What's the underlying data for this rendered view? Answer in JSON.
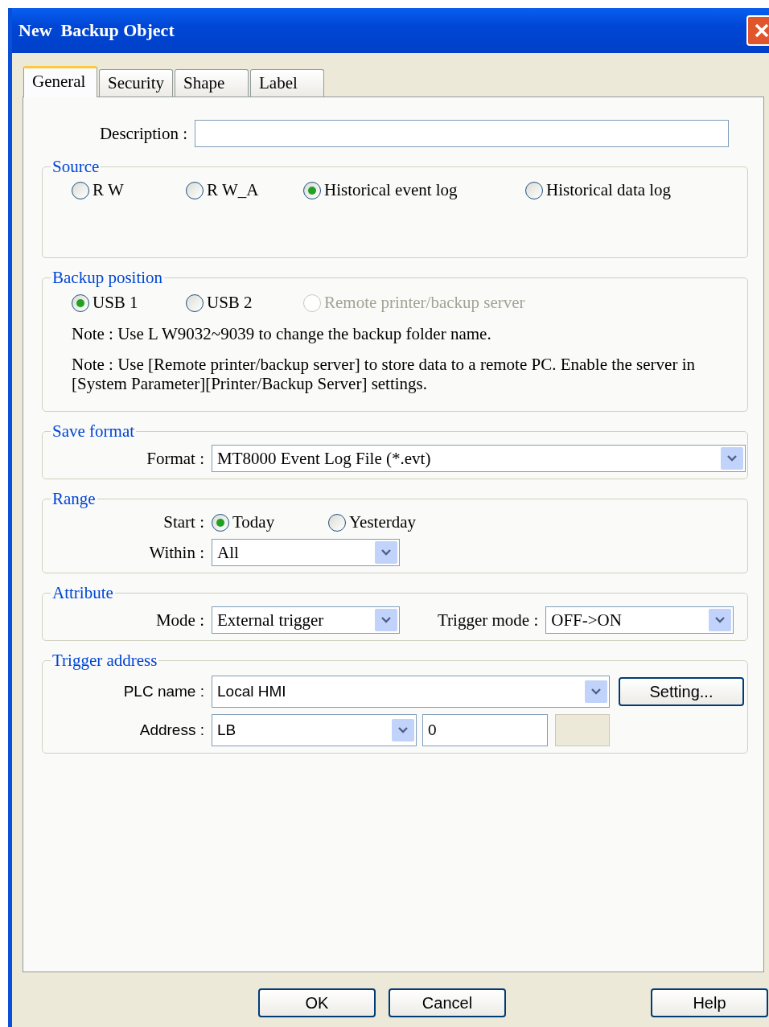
{
  "window": {
    "title": "New  Backup Object"
  },
  "tabs": [
    {
      "label": "General",
      "selected": true
    },
    {
      "label": "Security",
      "selected": false
    },
    {
      "label": "Shape",
      "selected": false
    },
    {
      "label": "Label",
      "selected": false
    }
  ],
  "description": {
    "label": "Description :"
  },
  "source": {
    "legend": "Source",
    "options": [
      {
        "label": "R W",
        "selected": false
      },
      {
        "label": "R W_A",
        "selected": false
      },
      {
        "label": "Historical event log",
        "selected": true
      },
      {
        "label": "Historical data log",
        "selected": false
      }
    ]
  },
  "backup_position": {
    "legend": "Backup position",
    "options": [
      {
        "label": "USB 1",
        "selected": true,
        "disabled": false
      },
      {
        "label": "USB 2",
        "selected": false,
        "disabled": false
      },
      {
        "label": "Remote printer/backup server",
        "selected": false,
        "disabled": true
      }
    ],
    "notes": [
      "Note : Use L W9032~9039 to change the backup folder name.",
      "Note : Use [Remote printer/backup server] to store data to a remote PC. Enable the server in [System Parameter][Printer/Backup Server] settings."
    ]
  },
  "save_format": {
    "legend": "Save format",
    "format": {
      "label": "Format :",
      "value": "MT8000 Event Log File (*.evt)"
    }
  },
  "range": {
    "legend": "Range",
    "start_label": "Start :",
    "start_options": [
      {
        "label": "Today",
        "selected": true
      },
      {
        "label": "Yesterday",
        "selected": false
      }
    ],
    "within": {
      "label": "Within :",
      "value": "All"
    }
  },
  "attribute": {
    "legend": "Attribute",
    "mode": {
      "label": "Mode :",
      "value": "External trigger"
    },
    "trigger_mode": {
      "label": "Trigger mode :",
      "value": "OFF->ON"
    }
  },
  "trigger_address": {
    "legend": "Trigger address",
    "plc_name": {
      "label": "PLC name :",
      "value": "Local HMI"
    },
    "setting_button": "Setting...",
    "address": {
      "label": "Address :",
      "value": "LB"
    },
    "address_number": "0"
  },
  "buttons": [
    {
      "label": "OK"
    },
    {
      "label": "Cancel"
    },
    {
      "label": "Help"
    }
  ]
}
